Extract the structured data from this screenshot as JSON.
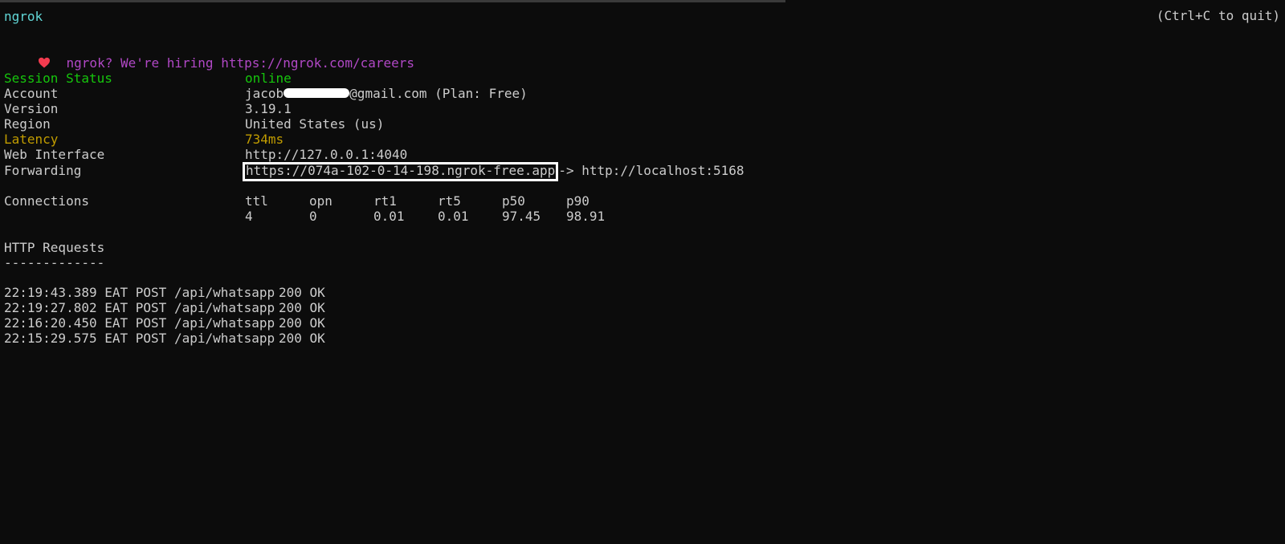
{
  "terminal": {
    "app_name": "ngrok",
    "quit_hint": "(Ctrl+C to quit)",
    "hiring_text": "ngrok? We're hiring https://ngrok.com/careers",
    "heart_icon": "heart-icon"
  },
  "session": {
    "status_label": "Session Status",
    "status_value": "online",
    "account_label": "Account",
    "account_prefix": "jacob",
    "account_suffix": "@gmail.com (Plan: Free)",
    "version_label": "Version",
    "version_value": "3.19.1",
    "region_label": "Region",
    "region_value": "United States (us)",
    "latency_label": "Latency",
    "latency_value": "734ms",
    "web_label": "Web Interface",
    "web_value": "http://127.0.0.1:4040",
    "forwarding_label": "Forwarding",
    "forwarding_url": "https://074a-102-0-14-198.ngrok-free.app",
    "forwarding_target": "-> http://localhost:5168"
  },
  "connections": {
    "label": "Connections",
    "headers": [
      "ttl",
      "opn",
      "rt1",
      "rt5",
      "p50",
      "p90"
    ],
    "values": [
      "4",
      "0",
      "0.01",
      "0.01",
      "97.45",
      "98.91"
    ]
  },
  "http_requests": {
    "title": "HTTP Requests",
    "underline": "-------------",
    "rows": [
      {
        "time": "22:19:43.389 EAT",
        "method": "POST",
        "path": "/api/whatsapp",
        "status": "200 OK"
      },
      {
        "time": "22:19:27.802 EAT",
        "method": "POST",
        "path": "/api/whatsapp",
        "status": "200 OK"
      },
      {
        "time": "22:16:20.450 EAT",
        "method": "POST",
        "path": "/api/whatsapp",
        "status": "200 OK"
      },
      {
        "time": "22:15:29.575 EAT",
        "method": "POST",
        "path": "/api/whatsapp",
        "status": "200 OK"
      }
    ]
  },
  "colors": {
    "background": "#0c0c0c",
    "foreground": "#cccccc",
    "cyan": "#61d6d6",
    "magenta": "#b148c6",
    "green": "#16c60c",
    "amber": "#c19c00"
  }
}
